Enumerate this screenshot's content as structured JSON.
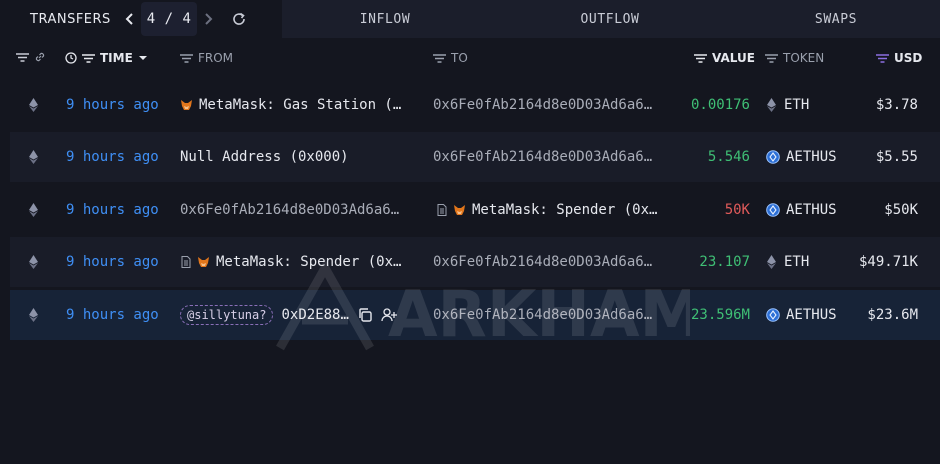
{
  "tabs": {
    "transfers_label": "TRANSFERS",
    "page_current": "4",
    "page_sep": "/",
    "page_total": "4",
    "inflow_label": "INFLOW",
    "outflow_label": "OUTFLOW",
    "swaps_label": "SWAPS"
  },
  "header": {
    "time": "TIME",
    "from": "FROM",
    "to": "TO",
    "value": "VALUE",
    "token": "TOKEN",
    "usd": "USD"
  },
  "watermark": "ARKHAM",
  "rows": [
    {
      "time": "9 hours ago",
      "from": "MetaMask: Gas Station (…",
      "to": "0x6Fe0fAb2164d8e0D03Ad6a6…",
      "value": "0.00176",
      "token": "ETH",
      "usd": "$3.78"
    },
    {
      "time": "9 hours ago",
      "from": "Null Address (0x000)",
      "to": "0x6Fe0fAb2164d8e0D03Ad6a6…",
      "value": "5.546",
      "token": "AETHUS",
      "usd": "$5.55"
    },
    {
      "time": "9 hours ago",
      "from": "0x6Fe0fAb2164d8e0D03Ad6a6…",
      "to": "MetaMask: Spender (0x…",
      "value": "50K",
      "token": "AETHUS",
      "usd": "$50K"
    },
    {
      "time": "9 hours ago",
      "from": "MetaMask: Spender (0x…",
      "to": "0x6Fe0fAb2164d8e0D03Ad6a6…",
      "value": "23.107",
      "token": "ETH",
      "usd": "$49.71K"
    },
    {
      "time": "9 hours ago",
      "from_tag": "@sillytuna?",
      "from": "0xD2E88…",
      "to": "0x6Fe0fAb2164d8e0D03Ad6a6…",
      "value": "23.596M",
      "token": "AETHUS",
      "usd": "$23.6M"
    }
  ],
  "colors": {
    "time_link": "#3f8ff5",
    "positive": "#3fbf75",
    "negative": "#e05a5a",
    "highlight_row": "#172337"
  },
  "icons": [
    "chevron-left-icon",
    "chevron-right-icon",
    "refresh-icon",
    "filter-icon",
    "link-icon",
    "clock-icon",
    "sort-down-icon",
    "eth-icon",
    "aethus-coin-icon",
    "metamask-fox-icon",
    "contract-doc-icon",
    "copy-icon",
    "add-user-icon"
  ]
}
